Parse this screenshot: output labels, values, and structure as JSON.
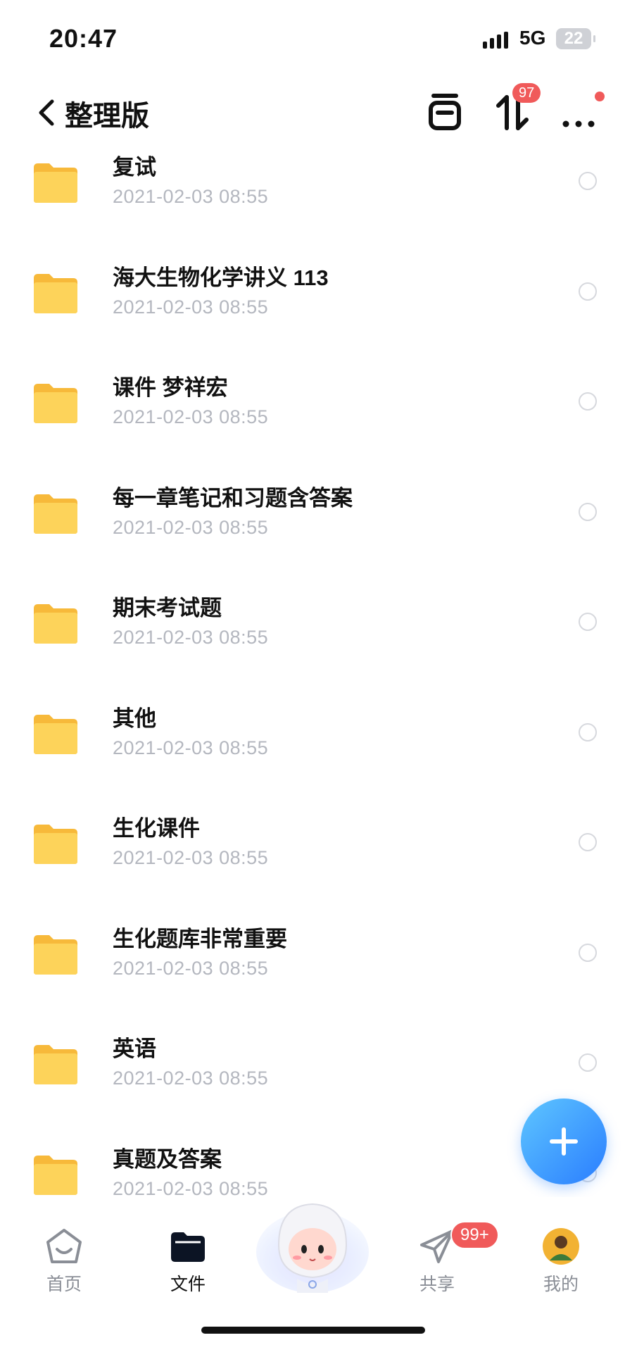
{
  "status_bar": {
    "time": "20:47",
    "network": "5G",
    "battery": "22"
  },
  "header": {
    "title": "整理版",
    "sort_badge": "97"
  },
  "files": [
    {
      "name": "复试",
      "date": "2021-02-03 08:55"
    },
    {
      "name": "海大生物化学讲义 113",
      "date": "2021-02-03 08:55"
    },
    {
      "name": "课件 梦祥宏",
      "date": "2021-02-03 08:55"
    },
    {
      "name": "每一章笔记和习题含答案",
      "date": "2021-02-03 08:55"
    },
    {
      "name": "期末考试题",
      "date": "2021-02-03 08:55"
    },
    {
      "name": "其他",
      "date": "2021-02-03 08:55"
    },
    {
      "name": "生化课件",
      "date": "2021-02-03 08:55"
    },
    {
      "name": "生化题库非常重要",
      "date": "2021-02-03 08:55"
    },
    {
      "name": "英语",
      "date": "2021-02-03 08:55"
    },
    {
      "name": "真题及答案",
      "date": "2021-02-03 08:55"
    }
  ],
  "tabbar": {
    "home": "首页",
    "files": "文件",
    "share": "共享",
    "share_badge": "99+",
    "me": "我的"
  },
  "icons": {
    "back": "chevron-left-icon",
    "archive": "archive-box-icon",
    "sort": "sort-arrows-icon",
    "more": "more-dots-icon",
    "folder": "folder-icon",
    "add": "plus-icon"
  },
  "colors": {
    "folder": "#fcd250",
    "accent": "#2a7dff",
    "badge": "#f05a5a"
  }
}
